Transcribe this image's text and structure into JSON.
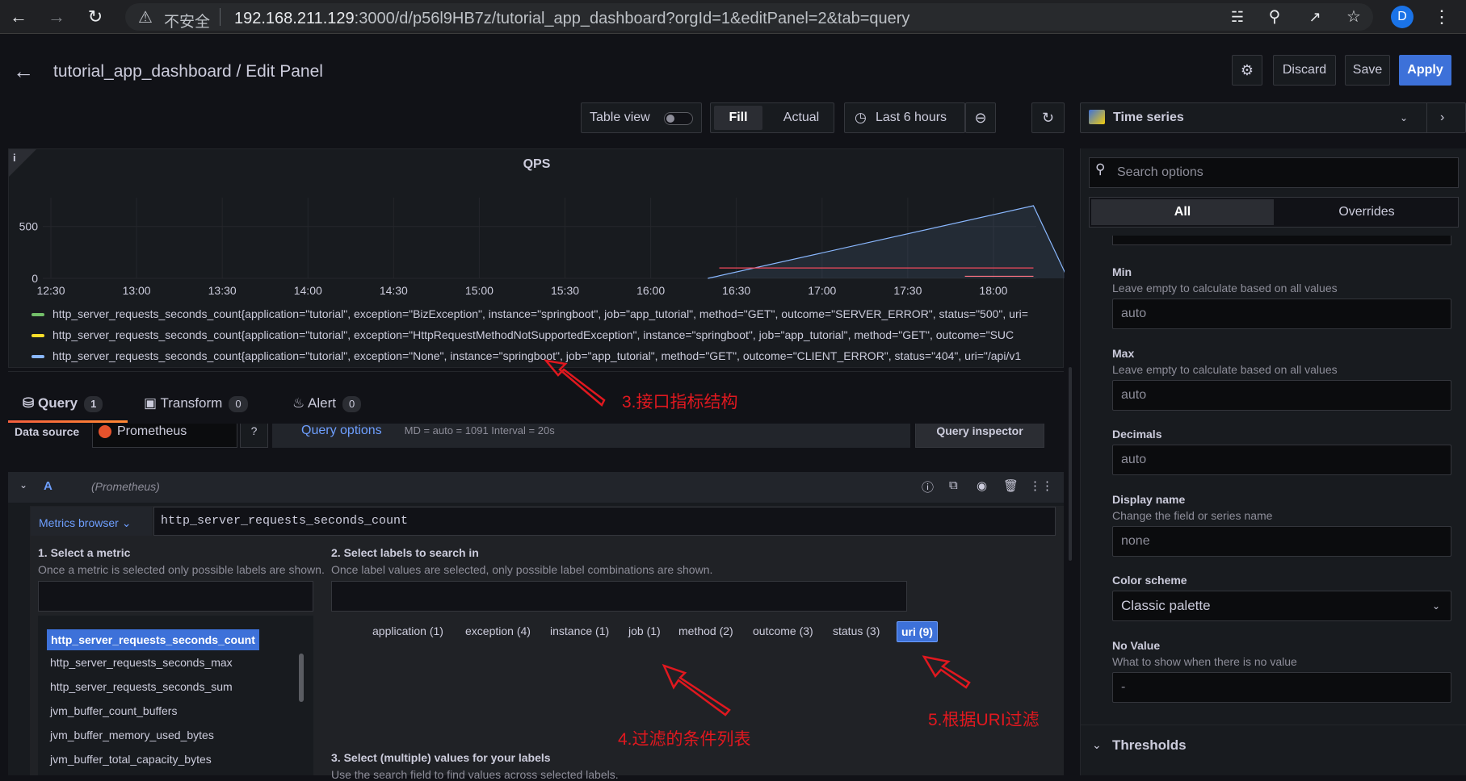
{
  "browser": {
    "insecure_label": "不安全",
    "url_host": "192.168.211.129",
    "url_rest": ":3000/d/p56l9HB7z/tutorial_app_dashboard?orgId=1&editPanel=2&tab=query",
    "profile_initial": "D"
  },
  "header": {
    "title": "tutorial_app_dashboard / Edit Panel",
    "discard_label": "Discard",
    "save_label": "Save",
    "apply_label": "Apply"
  },
  "toolbar": {
    "table_view_label": "Table view",
    "fill_label": "Fill",
    "actual_label": "Actual",
    "time_range_label": "Last 6 hours",
    "visualization_label": "Time series"
  },
  "panel": {
    "info_label": "i",
    "title": "QPS",
    "legend": [
      {
        "color": "#73bf69",
        "text": "http_server_requests_seconds_count{application=\"tutorial\", exception=\"BizException\", instance=\"springboot\", job=\"app_tutorial\", method=\"GET\", outcome=\"SERVER_ERROR\", status=\"500\", uri="
      },
      {
        "color": "#fade2a",
        "text": "http_server_requests_seconds_count{application=\"tutorial\", exception=\"HttpRequestMethodNotSupportedException\", instance=\"springboot\", job=\"app_tutorial\", method=\"GET\", outcome=\"SUC"
      },
      {
        "color": "#8ab8ff",
        "text": "http_server_requests_seconds_count{application=\"tutorial\", exception=\"None\", instance=\"springboot\", job=\"app_tutorial\", method=\"GET\", outcome=\"CLIENT_ERROR\", status=\"404\", uri=\"/api/v1"
      }
    ]
  },
  "chart_data": {
    "type": "line",
    "title": "QPS",
    "x_ticks": [
      "12:30",
      "13:00",
      "13:30",
      "14:00",
      "14:30",
      "15:00",
      "15:30",
      "16:00",
      "16:30",
      "17:00",
      "17:30",
      "18:00"
    ],
    "y_ticks": [
      "0",
      "500"
    ],
    "ylim": [
      0,
      700
    ],
    "series": [
      {
        "color": "#8ab8ff",
        "x": [
          "16:20",
          "18:14",
          "18:26"
        ],
        "y": [
          0,
          700,
          0
        ]
      },
      {
        "color": "#f2495c",
        "x": [
          "16:24",
          "18:14"
        ],
        "y": [
          100,
          100
        ]
      },
      {
        "color": "#ff7383",
        "x": [
          "17:50",
          "18:14"
        ],
        "y": [
          20,
          20
        ]
      }
    ]
  },
  "query_tabs": [
    {
      "label": "Query",
      "count": "1"
    },
    {
      "label": "Transform",
      "count": "0"
    },
    {
      "label": "Alert",
      "count": "0"
    }
  ],
  "query_row": {
    "datasource_label": "Data source",
    "datasource_value": "Prometheus",
    "query_options_label": "Query options",
    "query_options_meta": "MD = auto = 1091   Interval = 20s",
    "query_inspector_label": "Query inspector",
    "ref_id": "A",
    "ref_source": "(Prometheus)"
  },
  "metrics_browser": {
    "button_label": "Metrics browser",
    "query_text": "http_server_requests_seconds_count",
    "step1_title": "1. Select a metric",
    "step1_desc": "Once a metric is selected only possible labels are shown.",
    "step2_title": "2. Select labels to search in",
    "step2_desc": "Once label values are selected, only possible label combinations are shown.",
    "step3_title": "3. Select (multiple) values for your labels",
    "step3_desc": "Use the search field to find values across selected labels.",
    "metrics": [
      "http_server_requests_seconds_count",
      "http_server_requests_seconds_max",
      "http_server_requests_seconds_sum",
      "jvm_buffer_count_buffers",
      "jvm_buffer_memory_used_bytes",
      "jvm_buffer_total_capacity_bytes"
    ],
    "labels": [
      "application (1)",
      "exception (4)",
      "instance (1)",
      "job (1)",
      "method (2)",
      "outcome (3)",
      "status (3)",
      "uri (9)"
    ]
  },
  "options": {
    "search_placeholder": "Search options",
    "all_tab": "All",
    "overrides_tab": "Overrides",
    "min_label": "Min",
    "min_desc": "Leave empty to calculate based on all values",
    "min_value": "auto",
    "max_label": "Max",
    "max_desc": "Leave empty to calculate based on all values",
    "max_value": "auto",
    "decimals_label": "Decimals",
    "decimals_value": "auto",
    "display_name_label": "Display name",
    "display_name_desc": "Change the field or series name",
    "display_name_value": "none",
    "color_scheme_label": "Color scheme",
    "color_scheme_value": "Classic palette",
    "no_value_label": "No Value",
    "no_value_desc": "What to show when there is no value",
    "no_value_value": "-",
    "thresholds_label": "Thresholds"
  },
  "annotations": {
    "a3": "3.接口指标结构",
    "a4": "4.过滤的条件列表",
    "a5": "5.根据URI过滤"
  },
  "colors": {
    "accent": "#3d71d9",
    "annotation": "#e0181f"
  }
}
